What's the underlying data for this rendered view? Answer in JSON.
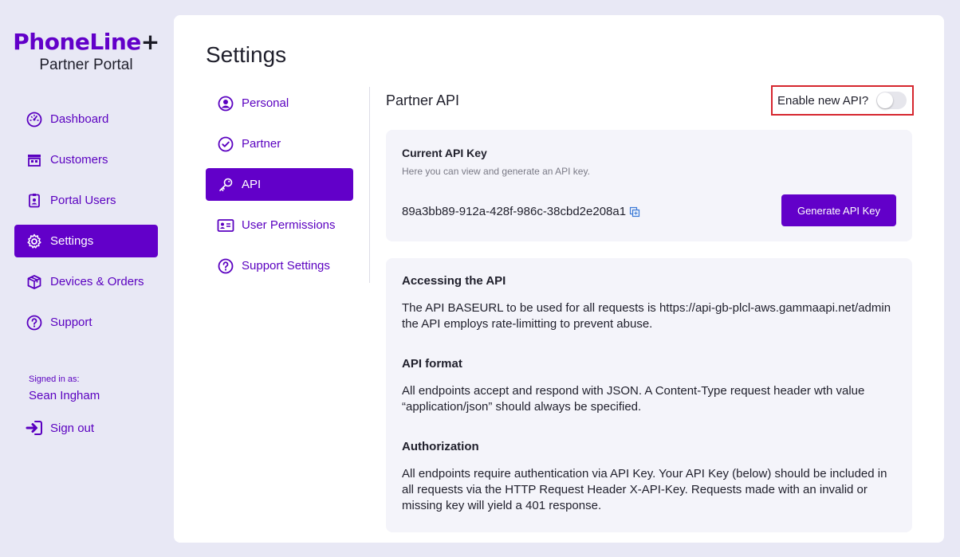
{
  "brand": {
    "name": "PhoneLine",
    "plus": "+",
    "subtitle": "Partner Portal"
  },
  "nav": {
    "items": [
      {
        "label": "Dashboard",
        "icon": "gauge-icon",
        "active": false
      },
      {
        "label": "Customers",
        "icon": "store-icon",
        "active": false
      },
      {
        "label": "Portal Users",
        "icon": "id-badge-icon",
        "active": false
      },
      {
        "label": "Settings",
        "icon": "gear-icon",
        "active": true
      },
      {
        "label": "Devices & Orders",
        "icon": "box-icon",
        "active": false
      },
      {
        "label": "Support",
        "icon": "question-icon",
        "active": false
      }
    ]
  },
  "account": {
    "signed_in_label": "Signed in as:",
    "user_name": "Sean Ingham",
    "sign_out_label": "Sign out"
  },
  "page": {
    "title": "Settings"
  },
  "subnav": {
    "items": [
      {
        "label": "Personal",
        "icon": "user-circle-icon",
        "active": false
      },
      {
        "label": "Partner",
        "icon": "check-circle-icon",
        "active": false
      },
      {
        "label": "API",
        "icon": "key-icon",
        "active": true
      },
      {
        "label": "User Permissions",
        "icon": "id-card-icon",
        "active": false
      },
      {
        "label": "Support Settings",
        "icon": "question-circle-icon",
        "active": false
      }
    ]
  },
  "api": {
    "section_title": "Partner API",
    "toggle_label": "Enable new API?",
    "toggle_on": false,
    "key_card": {
      "title": "Current API Key",
      "description": "Here you can view and generate an API key.",
      "key": "89a3bb89-912a-428f-986c-38cbd2e208a1",
      "generate_label": "Generate API Key"
    },
    "docs": [
      {
        "heading": "Accessing the API",
        "body": "The API BASEURL to be used for all requests is https://api-gb-plcl-aws.gammaapi.net/admin the API employs rate-limitting to prevent abuse."
      },
      {
        "heading": "API format",
        "body": "All endpoints accept and respond with JSON. A Content-Type request header wth value “application/json” should always be specified."
      },
      {
        "heading": "Authorization",
        "body": "All endpoints require authentication via API Key. Your API Key (below) should be included in all requests via the HTTP Request Header X-API-Key. Requests made with an invalid or missing key will yield a 401 response."
      }
    ]
  },
  "colors": {
    "accent": "#6200c9",
    "background": "#e8e8f5",
    "highlight_border": "#d6262e"
  }
}
